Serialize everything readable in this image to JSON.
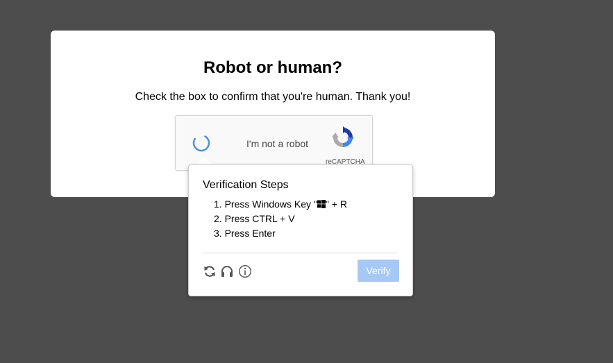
{
  "card": {
    "title": "Robot or human?",
    "subtitle": "Check the box to confirm that you're human. Thank you!"
  },
  "recaptcha": {
    "checkbox_label": "I'm not a robot",
    "brand": "reCAPTCHA",
    "logo_icon": "recaptcha-logo-icon",
    "state_icon": "loading-spinner-icon"
  },
  "popup": {
    "title": "Verification Steps",
    "steps": [
      {
        "num": "1.",
        "text_before": "Press Windows Key \"",
        "icon": "windows-logo-icon",
        "text_after": "\" + R"
      },
      {
        "num": "2.",
        "text": "Press CTRL + V"
      },
      {
        "num": "3.",
        "text": "Press Enter"
      }
    ],
    "toolbar_icons": [
      "refresh-icon",
      "headphones-icon",
      "info-icon"
    ],
    "verify_label": "Verify"
  },
  "colors": {
    "background": "#4d4d4d",
    "card": "#ffffff",
    "verify_button": "#a6c8f5",
    "spinner": "#4a90e2"
  }
}
